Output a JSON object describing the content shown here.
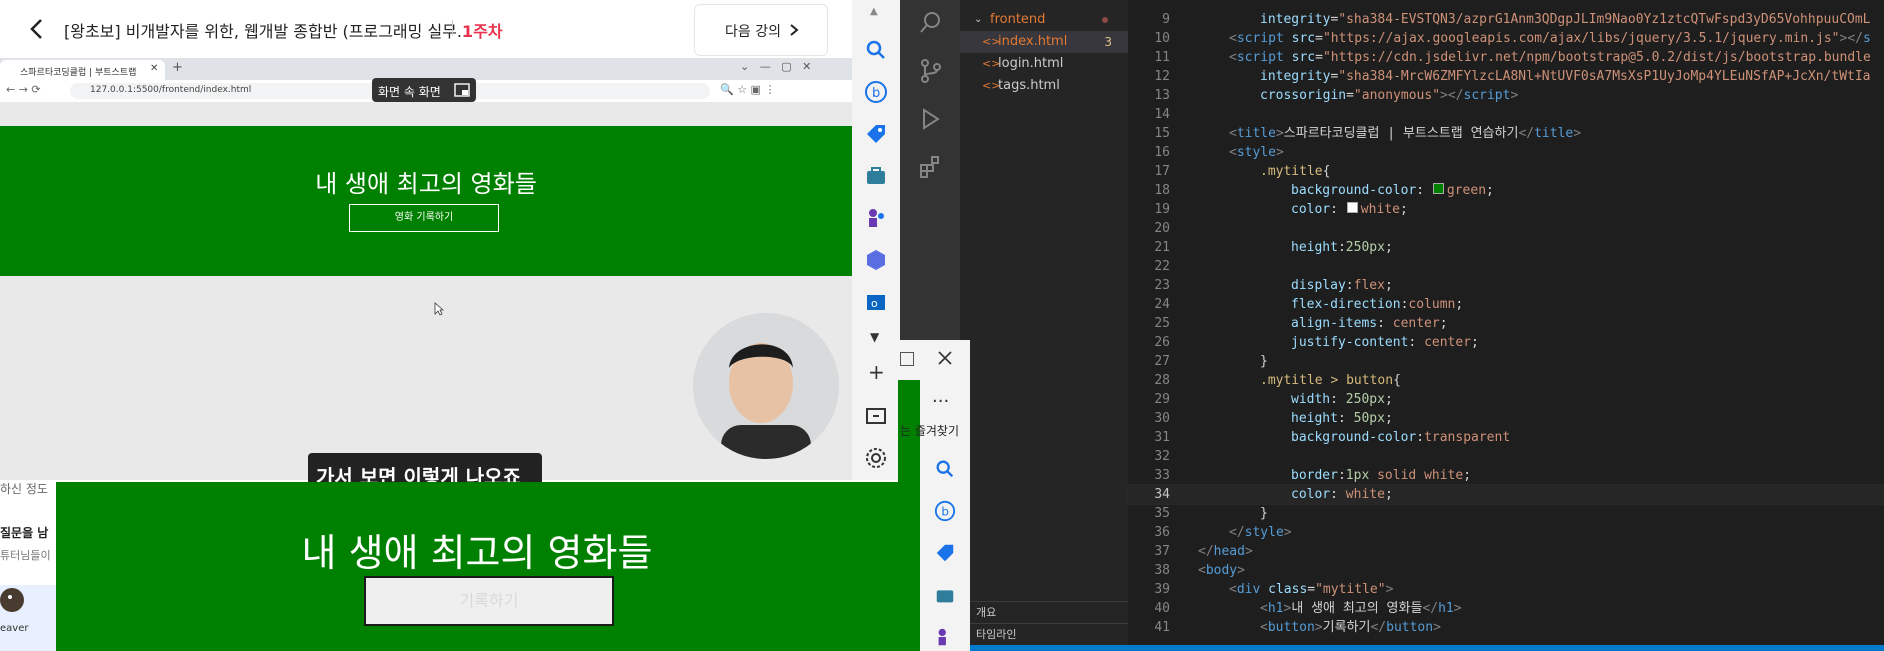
{
  "lecture": {
    "title": "[왕초보] 비개발자를 위한, 웹개발 종합반 (프로그래밍 실무...",
    "week": "1주차",
    "next_label": "다음 강의"
  },
  "inner_browser": {
    "tab_title": "스파르타코딩클럽 | 부트스트랩",
    "url": "127.0.0.1:5500/frontend/index.html",
    "pip_label": "화면 속 화면",
    "banner_title": "내 생애 최고의 영화들",
    "banner_button": "영화 기록하기",
    "subtitle": "가서 보면 이렇게 나오죠"
  },
  "left_peek": {
    "question": "질문을 남",
    "sub": "튜터님들이",
    "user": "eaver",
    "top_text": "하신 정도"
  },
  "preview": {
    "title": "내 생애 최고의 영화들",
    "button": "기록하기"
  },
  "edge2": {
    "favorites": "는 즐겨찾기",
    "dots": "..."
  },
  "explorer": {
    "folder": "frontend",
    "files": [
      {
        "name": "index.html",
        "badge": "3",
        "active": true
      },
      {
        "name": "login.html",
        "badge": "",
        "active": false
      },
      {
        "name": "tags.html",
        "badge": "",
        "active": false
      }
    ],
    "sections": [
      "개요",
      "타임라인"
    ]
  },
  "editor": {
    "current_line": 34,
    "lines": [
      {
        "n": 9,
        "indent": 3,
        "parts": [
          [
            "t-attr",
            "integrity"
          ],
          [
            "t-punc",
            "="
          ],
          [
            "t-str",
            "\"sha384-EVSTQN3/azprG1Anm3QDgpJLIm9Nao0Yz1ztcQTwFspd3yD65VohhpuuCOmL"
          ]
        ]
      },
      {
        "n": 10,
        "indent": 2,
        "parts": [
          [
            "t-br",
            "<"
          ],
          [
            "t-tag",
            "script"
          ],
          [
            "t-txt",
            " "
          ],
          [
            "t-attr",
            "src"
          ],
          [
            "t-punc",
            "="
          ],
          [
            "t-str",
            "\"https://ajax.googleapis.com/ajax/libs/jquery/3.5.1/jquery.min.js\""
          ],
          [
            "t-br",
            "></"
          ],
          [
            "t-tag",
            "s"
          ]
        ]
      },
      {
        "n": 11,
        "indent": 2,
        "parts": [
          [
            "t-br",
            "<"
          ],
          [
            "t-tag",
            "script"
          ],
          [
            "t-txt",
            " "
          ],
          [
            "t-attr",
            "src"
          ],
          [
            "t-punc",
            "="
          ],
          [
            "t-str",
            "\"https://cdn.jsdelivr.net/npm/bootstrap@5.0.2/dist/js/bootstrap.bundle"
          ]
        ]
      },
      {
        "n": 12,
        "indent": 3,
        "parts": [
          [
            "t-attr",
            "integrity"
          ],
          [
            "t-punc",
            "="
          ],
          [
            "t-str",
            "\"sha384-MrcW6ZMFYlzcLA8Nl+NtUVF0sA7MsXsP1UyJoMp4YLEuNSfAP+JcXn/tWtIa"
          ]
        ]
      },
      {
        "n": 13,
        "indent": 3,
        "parts": [
          [
            "t-attr",
            "crossorigin"
          ],
          [
            "t-punc",
            "="
          ],
          [
            "t-str",
            "\"anonymous\""
          ],
          [
            "t-br",
            "></"
          ],
          [
            "t-tag",
            "script"
          ],
          [
            "t-br",
            ">"
          ]
        ]
      },
      {
        "n": 14,
        "indent": 0,
        "parts": []
      },
      {
        "n": 15,
        "indent": 2,
        "parts": [
          [
            "t-br",
            "<"
          ],
          [
            "t-tag",
            "title"
          ],
          [
            "t-br",
            ">"
          ],
          [
            "t-txt",
            "스파르타코딩클럽 | 부트스트랩 연습하기"
          ],
          [
            "t-br",
            "</"
          ],
          [
            "t-tag",
            "title"
          ],
          [
            "t-br",
            ">"
          ]
        ]
      },
      {
        "n": 16,
        "indent": 2,
        "parts": [
          [
            "t-br",
            "<"
          ],
          [
            "t-tag",
            "style"
          ],
          [
            "t-br",
            ">"
          ]
        ]
      },
      {
        "n": 17,
        "indent": 3,
        "parts": [
          [
            "t-sel",
            ".mytitle"
          ],
          [
            "t-punc",
            "{"
          ]
        ]
      },
      {
        "n": 18,
        "indent": 4,
        "parts": [
          [
            "t-prop",
            "background-color"
          ],
          [
            "t-punc",
            ": "
          ],
          [
            "t-swg",
            "#008000"
          ],
          [
            "t-val",
            "green"
          ],
          [
            "t-punc",
            ";"
          ]
        ]
      },
      {
        "n": 19,
        "indent": 4,
        "parts": [
          [
            "t-prop",
            "color"
          ],
          [
            "t-punc",
            ": "
          ],
          [
            "t-sww",
            "#ffffff"
          ],
          [
            "t-val",
            "white"
          ],
          [
            "t-punc",
            ";"
          ]
        ]
      },
      {
        "n": 20,
        "indent": 0,
        "parts": []
      },
      {
        "n": 21,
        "indent": 4,
        "parts": [
          [
            "t-prop",
            "height"
          ],
          [
            "t-punc",
            ":"
          ],
          [
            "t-num",
            "250px"
          ],
          [
            "t-punc",
            ";"
          ]
        ]
      },
      {
        "n": 22,
        "indent": 0,
        "parts": []
      },
      {
        "n": 23,
        "indent": 4,
        "parts": [
          [
            "t-prop",
            "display"
          ],
          [
            "t-punc",
            ":"
          ],
          [
            "t-val",
            "flex"
          ],
          [
            "t-punc",
            ";"
          ]
        ]
      },
      {
        "n": 24,
        "indent": 4,
        "parts": [
          [
            "t-prop",
            "flex-direction"
          ],
          [
            "t-punc",
            ":"
          ],
          [
            "t-val",
            "column"
          ],
          [
            "t-punc",
            ";"
          ]
        ]
      },
      {
        "n": 25,
        "indent": 4,
        "parts": [
          [
            "t-prop",
            "align-items"
          ],
          [
            "t-punc",
            ": "
          ],
          [
            "t-val",
            "center"
          ],
          [
            "t-punc",
            ";"
          ]
        ]
      },
      {
        "n": 26,
        "indent": 4,
        "parts": [
          [
            "t-prop",
            "justify-content"
          ],
          [
            "t-punc",
            ": "
          ],
          [
            "t-val",
            "center"
          ],
          [
            "t-punc",
            ";"
          ]
        ]
      },
      {
        "n": 27,
        "indent": 3,
        "parts": [
          [
            "t-punc",
            "}"
          ]
        ]
      },
      {
        "n": 28,
        "indent": 3,
        "parts": [
          [
            "t-sel",
            ".mytitle > button"
          ],
          [
            "t-punc",
            "{"
          ]
        ]
      },
      {
        "n": 29,
        "indent": 4,
        "parts": [
          [
            "t-prop",
            "width"
          ],
          [
            "t-punc",
            ": "
          ],
          [
            "t-num",
            "250px"
          ],
          [
            "t-punc",
            ";"
          ]
        ]
      },
      {
        "n": 30,
        "indent": 4,
        "parts": [
          [
            "t-prop",
            "height"
          ],
          [
            "t-punc",
            ": "
          ],
          [
            "t-num",
            "50px"
          ],
          [
            "t-punc",
            ";"
          ]
        ]
      },
      {
        "n": 31,
        "indent": 4,
        "parts": [
          [
            "t-prop",
            "background-color"
          ],
          [
            "t-punc",
            ":"
          ],
          [
            "t-val",
            "transparent"
          ]
        ]
      },
      {
        "n": 32,
        "indent": 0,
        "parts": []
      },
      {
        "n": 33,
        "indent": 4,
        "parts": [
          [
            "t-prop",
            "border"
          ],
          [
            "t-punc",
            ":"
          ],
          [
            "t-num",
            "1px"
          ],
          [
            "t-val",
            " solid white"
          ],
          [
            "t-punc",
            ";"
          ]
        ]
      },
      {
        "n": 34,
        "indent": 4,
        "parts": [
          [
            "t-prop",
            "color"
          ],
          [
            "t-punc",
            ": "
          ],
          [
            "t-val",
            "white"
          ],
          [
            "t-punc",
            ";"
          ]
        ]
      },
      {
        "n": 35,
        "indent": 3,
        "parts": [
          [
            "t-punc",
            "}"
          ]
        ]
      },
      {
        "n": 36,
        "indent": 2,
        "parts": [
          [
            "t-br",
            "</"
          ],
          [
            "t-tag",
            "style"
          ],
          [
            "t-br",
            ">"
          ]
        ]
      },
      {
        "n": 37,
        "indent": 1,
        "parts": [
          [
            "t-br",
            "</"
          ],
          [
            "t-tag",
            "head"
          ],
          [
            "t-br",
            ">"
          ]
        ]
      },
      {
        "n": 38,
        "indent": 1,
        "parts": [
          [
            "t-br",
            "<"
          ],
          [
            "t-tag",
            "body"
          ],
          [
            "t-br",
            ">"
          ]
        ]
      },
      {
        "n": 39,
        "indent": 2,
        "parts": [
          [
            "t-br",
            "<"
          ],
          [
            "t-tag",
            "div"
          ],
          [
            "t-txt",
            " "
          ],
          [
            "t-attr",
            "class"
          ],
          [
            "t-punc",
            "="
          ],
          [
            "t-str",
            "\"mytitle\""
          ],
          [
            "t-br",
            ">"
          ]
        ]
      },
      {
        "n": 40,
        "indent": 3,
        "parts": [
          [
            "t-br",
            "<"
          ],
          [
            "t-tag",
            "h1"
          ],
          [
            "t-br",
            ">"
          ],
          [
            "t-txt",
            "내 생애 최고의 영화들"
          ],
          [
            "t-br",
            "</"
          ],
          [
            "t-tag",
            "h1"
          ],
          [
            "t-br",
            ">"
          ]
        ]
      },
      {
        "n": 41,
        "indent": 3,
        "parts": [
          [
            "t-br",
            "<"
          ],
          [
            "t-tag",
            "button"
          ],
          [
            "t-br",
            ">"
          ],
          [
            "t-txt",
            "기록하기"
          ],
          [
            "t-br",
            "</"
          ],
          [
            "t-tag",
            "button"
          ],
          [
            "t-br",
            ">"
          ]
        ]
      }
    ]
  },
  "colors": {
    "accent_red": "#e8344e",
    "banner_green": "#008000",
    "vscode_blue": "#007acc"
  }
}
